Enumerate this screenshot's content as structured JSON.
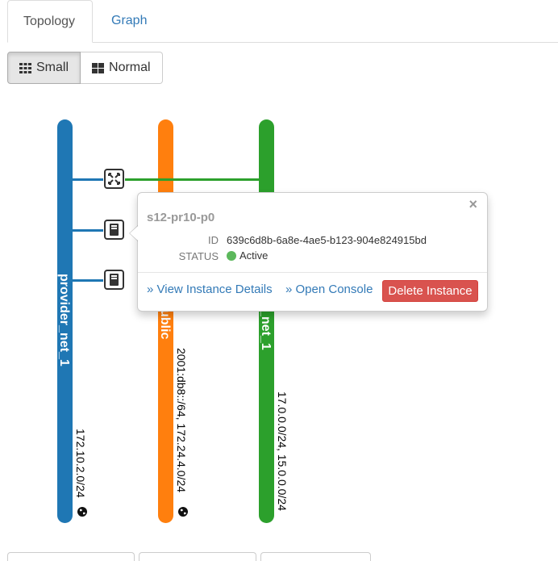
{
  "tabs": [
    {
      "label": "Topology",
      "active": true
    },
    {
      "label": "Graph",
      "active": false
    }
  ],
  "size_toggle": {
    "small_label": "Small",
    "normal_label": "Normal",
    "selected": "Small"
  },
  "networks": [
    {
      "name": "provider_net_1",
      "color": "#1f77b4",
      "cidr": "172.10.2.0/24"
    },
    {
      "name": "public",
      "visible_name": "ublic",
      "color": "#ff7f0e",
      "cidr": "2001:db8::/64, 172.24.4.0/24"
    },
    {
      "name": "net_1",
      "visible_name": "_net_1",
      "color": "#2ca02c",
      "cidr": "17.0.0.0/24, 15.0.0.0/24"
    }
  ],
  "devices": [
    {
      "type": "router-icon"
    },
    {
      "type": "instance-icon"
    },
    {
      "type": "instance-icon"
    }
  ],
  "popover": {
    "title": "s12-pr10-p0",
    "id_label": "ID",
    "id_value": "639c6d8b-6a8e-4ae5-b123-904e824915bd",
    "status_label": "STATUS",
    "status_value": "Active",
    "status_color": "#5cb85c",
    "close": "×",
    "view_details": "» View Instance Details",
    "open_console": "» Open Console",
    "delete_label": "Delete Instance"
  }
}
